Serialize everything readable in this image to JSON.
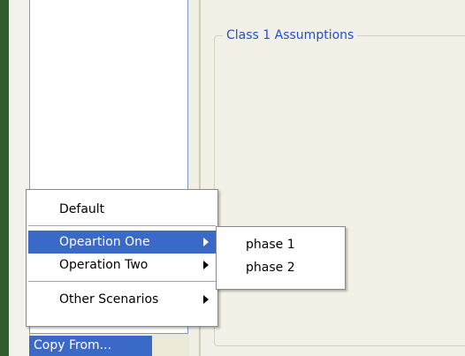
{
  "group_box": {
    "title": "Class 1 Assumptions"
  },
  "copy_button": {
    "label": "Copy From..."
  },
  "context_menu": {
    "items": [
      {
        "label": "Default"
      },
      {
        "label": "Opeartion One"
      },
      {
        "label": "Operation Two"
      },
      {
        "label": "Other Scenarios"
      }
    ],
    "highlight_color": "#3b69c8"
  },
  "submenu": {
    "items": [
      {
        "label": "phase 1"
      },
      {
        "label": "phase 2"
      }
    ]
  }
}
